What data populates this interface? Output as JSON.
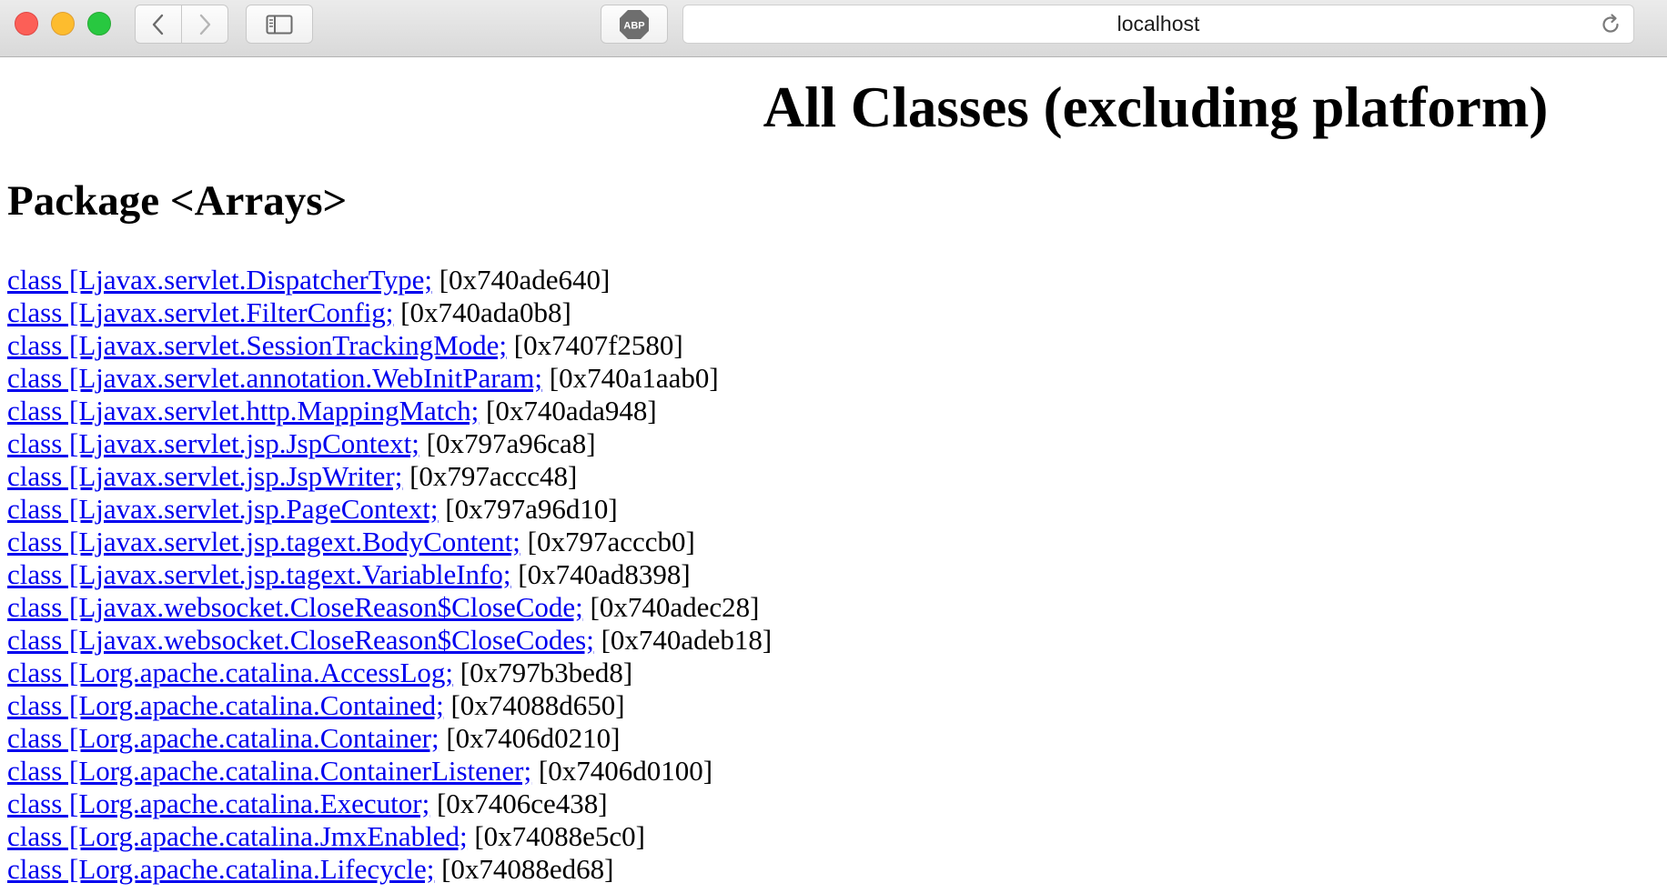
{
  "browser": {
    "url": "localhost",
    "abp_label": "ABP"
  },
  "page": {
    "title": "All Classes (excluding platform)",
    "package_heading": "Package <Arrays>",
    "classes": [
      {
        "name": "class [Ljavax.servlet.DispatcherType;",
        "address": "[0x740ade640]"
      },
      {
        "name": "class [Ljavax.servlet.FilterConfig;",
        "address": "[0x740ada0b8]"
      },
      {
        "name": "class [Ljavax.servlet.SessionTrackingMode;",
        "address": "[0x7407f2580]"
      },
      {
        "name": "class [Ljavax.servlet.annotation.WebInitParam;",
        "address": "[0x740a1aab0]"
      },
      {
        "name": "class [Ljavax.servlet.http.MappingMatch;",
        "address": "[0x740ada948]"
      },
      {
        "name": "class [Ljavax.servlet.jsp.JspContext;",
        "address": "[0x797a96ca8]"
      },
      {
        "name": "class [Ljavax.servlet.jsp.JspWriter;",
        "address": "[0x797accc48]"
      },
      {
        "name": "class [Ljavax.servlet.jsp.PageContext;",
        "address": "[0x797a96d10]"
      },
      {
        "name": "class [Ljavax.servlet.jsp.tagext.BodyContent;",
        "address": "[0x797acccb0]"
      },
      {
        "name": "class [Ljavax.servlet.jsp.tagext.VariableInfo;",
        "address": "[0x740ad8398]"
      },
      {
        "name": "class [Ljavax.websocket.CloseReason$CloseCode;",
        "address": "[0x740adec28]"
      },
      {
        "name": "class [Ljavax.websocket.CloseReason$CloseCodes;",
        "address": "[0x740adeb18]"
      },
      {
        "name": "class [Lorg.apache.catalina.AccessLog;",
        "address": "[0x797b3bed8]"
      },
      {
        "name": "class [Lorg.apache.catalina.Contained;",
        "address": "[0x74088d650]"
      },
      {
        "name": "class [Lorg.apache.catalina.Container;",
        "address": "[0x7406d0210]"
      },
      {
        "name": "class [Lorg.apache.catalina.ContainerListener;",
        "address": "[0x7406d0100]"
      },
      {
        "name": "class [Lorg.apache.catalina.Executor;",
        "address": "[0x7406ce438]"
      },
      {
        "name": "class [Lorg.apache.catalina.JmxEnabled;",
        "address": "[0x74088e5c0]"
      },
      {
        "name": "class [Lorg.apache.catalina.Lifecycle;",
        "address": "[0x74088ed68]"
      }
    ]
  }
}
